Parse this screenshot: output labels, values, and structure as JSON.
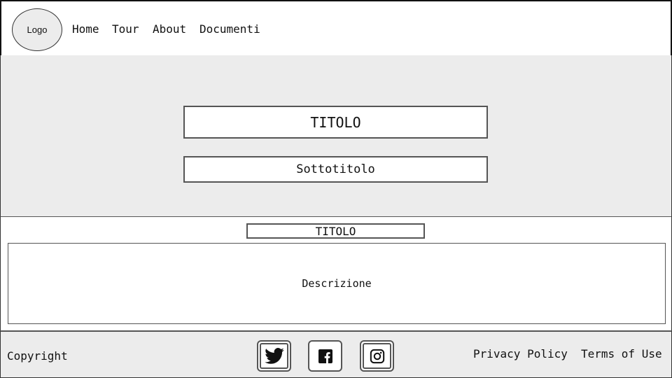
{
  "header": {
    "logo_label": "Logo",
    "nav": [
      "Home",
      "Tour",
      "About",
      "Documenti"
    ]
  },
  "hero": {
    "title": "TITOLO",
    "subtitle": "Sottotitolo"
  },
  "section": {
    "title": "TITOLO",
    "description": "Descrizione"
  },
  "footer": {
    "copyright": "Copyright",
    "social_icons": [
      "twitter-icon",
      "facebook-icon",
      "instagram-icon"
    ],
    "links": [
      "Privacy Policy",
      "Terms of Use"
    ]
  },
  "colors": {
    "background_gray": "#ececec",
    "border": "#555555",
    "text": "#111111"
  }
}
